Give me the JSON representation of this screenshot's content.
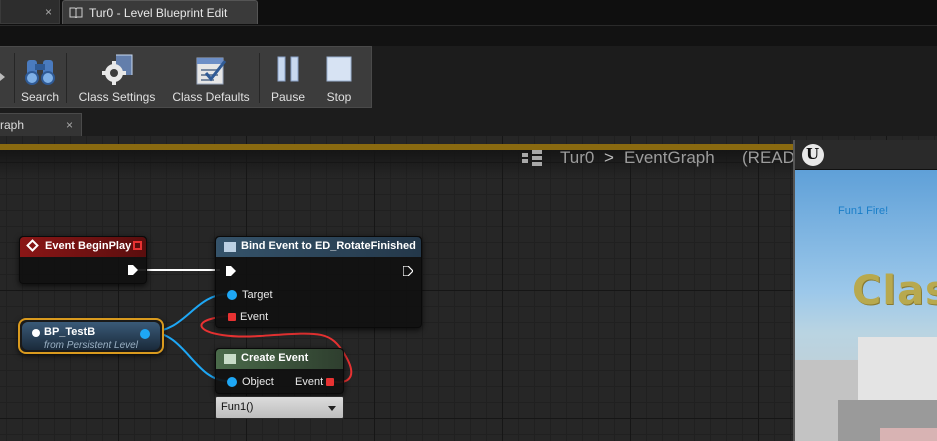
{
  "window": {
    "tab_title": "Tur0 - Level Blueprint Edit",
    "prev_tab_close": "×"
  },
  "toolbar": {
    "search_label": "Search",
    "class_settings_label": "Class Settings",
    "class_defaults_label": "Class Defaults",
    "pause_label": "Pause",
    "stop_label": "Stop"
  },
  "graph_tab": {
    "label": "raph",
    "close": "×"
  },
  "breadcrumb": {
    "level": "Tur0",
    "separator": ">",
    "graph": "EventGraph",
    "status": "(READ"
  },
  "nodes": {
    "begin_play": {
      "title": "Event BeginPlay"
    },
    "bind_event": {
      "title": "Bind Event to ED_RotateFinished",
      "target_label": "Target",
      "event_label": "Event"
    },
    "bp_testb": {
      "title": "BP_TestB",
      "subtitle": "from Persistent Level"
    },
    "create_event": {
      "title": "Create Event",
      "object_label": "Object",
      "event_label": "Event",
      "function_value": "Fun1()"
    }
  },
  "viewport": {
    "logo": "U",
    "debug_text": "Fun1 Fire!",
    "world_text": "Clas"
  },
  "colors": {
    "exec_white": "#ffffff",
    "object_pin": "#1ea7f5",
    "delegate_pin": "#e83232",
    "event_header": "#7a1414",
    "function_header": "#2e4a5e",
    "create_event_header": "#3e5a3e",
    "selection_outline": "#d99a1e"
  }
}
